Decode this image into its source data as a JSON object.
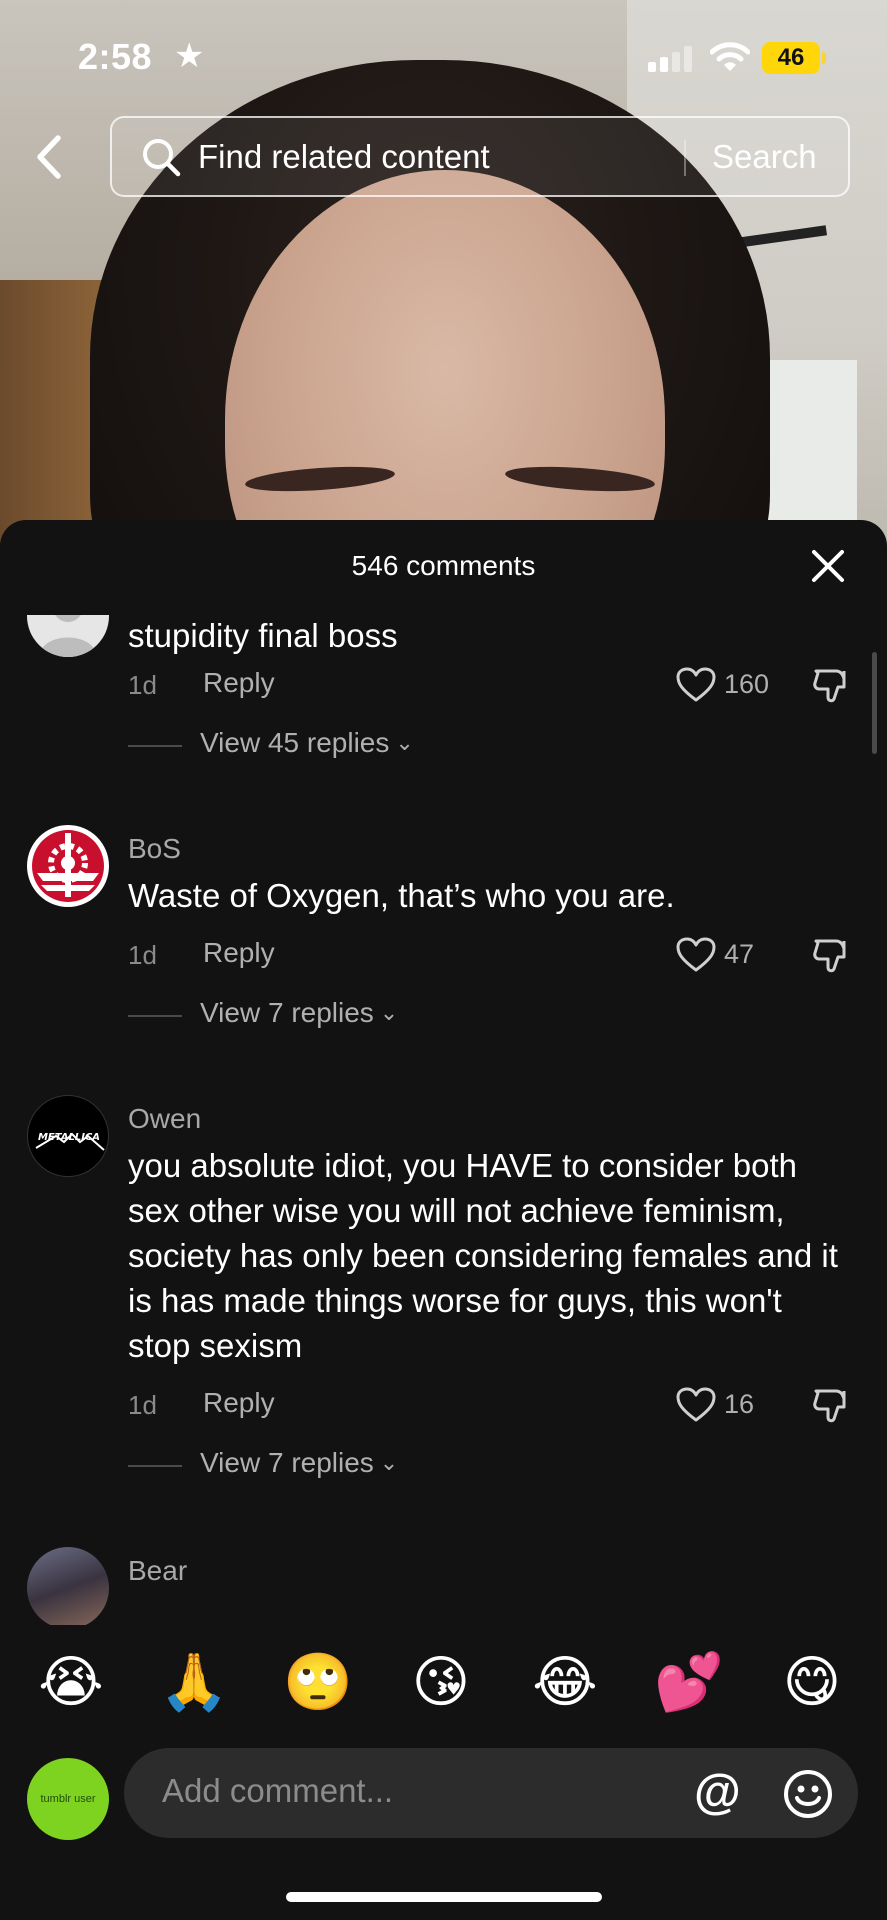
{
  "status_bar": {
    "time": "2:58",
    "battery": "46"
  },
  "search": {
    "placeholder": "Find related content",
    "button_label": "Search"
  },
  "comments_sheet": {
    "title": "546 comments",
    "comments": [
      {
        "author": "",
        "text": "stupidity final boss",
        "age": "1d",
        "reply_label": "Reply",
        "likes": "160",
        "view_replies": "View 45 replies"
      },
      {
        "author": "BoS",
        "text": "Waste of Oxygen, that’s who you are.",
        "age": "1d",
        "reply_label": "Reply",
        "likes": "47",
        "view_replies": "View 7 replies"
      },
      {
        "author": "Owen",
        "text": "you absolute idiot, you HAVE to consider both sex other wise you will not achieve feminism, society has only been considering females and it is has made things worse for guys, this won't stop sexism",
        "age": "1d",
        "reply_label": "Reply",
        "likes": "16",
        "view_replies": "View 7 replies",
        "avatar_text": "METALLICA"
      },
      {
        "author": "Bear"
      }
    ]
  },
  "emoji_bar": [
    "😭",
    "🙏",
    "🙄",
    "😘",
    "😂",
    "💕",
    "😋"
  ],
  "composer": {
    "placeholder": "Add comment...",
    "avatar_text": "tumblr user"
  },
  "colors": {
    "sheet_bg": "#121212",
    "battery": "#ffd60a",
    "my_avatar": "#7ed321"
  }
}
